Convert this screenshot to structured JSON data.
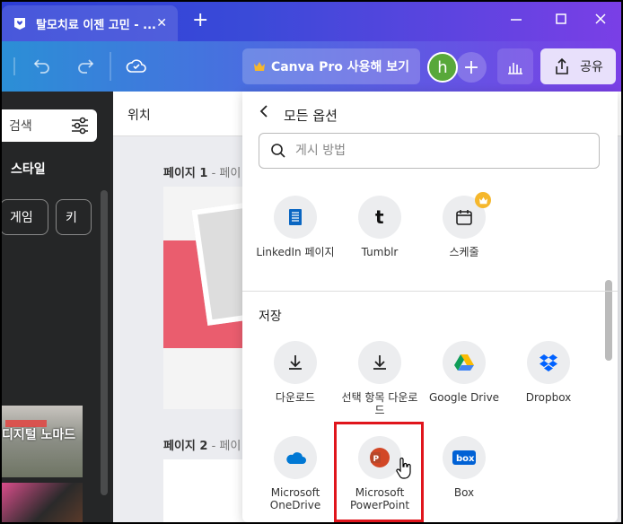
{
  "browser": {
    "tab_title": "탈모치료 이젠 고민 - ...",
    "tab_close": "✕",
    "new_tab": "+"
  },
  "toolbar": {
    "pro_button": "Canva Pro 사용해 보기",
    "avatar_letter": "h",
    "add_button": "+",
    "share_label": "공유"
  },
  "left_panel": {
    "search_text": "검색",
    "style_heading": "스타일",
    "chips": [
      "게임",
      "키"
    ],
    "thumb_title": "디지털 노마드"
  },
  "canvas": {
    "position_label": "위치",
    "page1_label": "페이지 1",
    "page1_sub": " - 페이",
    "page2_label": "페이지 2",
    "page2_sub": " - 페이"
  },
  "share_panel": {
    "title": "모든 옵션",
    "search_placeholder": "게시 방법",
    "social_options": [
      {
        "label": "LinkedIn 페이지",
        "icon": "linkedin-page-icon"
      },
      {
        "label": "Tumblr",
        "icon": "tumblr-icon"
      },
      {
        "label": "스케줄",
        "icon": "calendar-icon",
        "premium": true
      }
    ],
    "save_section_title": "저장",
    "save_options": [
      {
        "label": "다운로드",
        "icon": "download-icon"
      },
      {
        "label": "선택 항목 다운로드",
        "icon": "download-selected-icon"
      },
      {
        "label": "Google Drive",
        "icon": "google-drive-icon"
      },
      {
        "label": "Dropbox",
        "icon": "dropbox-icon"
      },
      {
        "label": "Microsoft OneDrive",
        "icon": "onedrive-icon"
      },
      {
        "label": "Microsoft PowerPoint",
        "icon": "powerpoint-icon",
        "highlighted": true
      },
      {
        "label": "Box",
        "icon": "box-icon"
      }
    ]
  },
  "colors": {
    "highlight_border": "#e0151c",
    "powerpoint": "#d24726",
    "premium_crown": "#f5b72c"
  }
}
